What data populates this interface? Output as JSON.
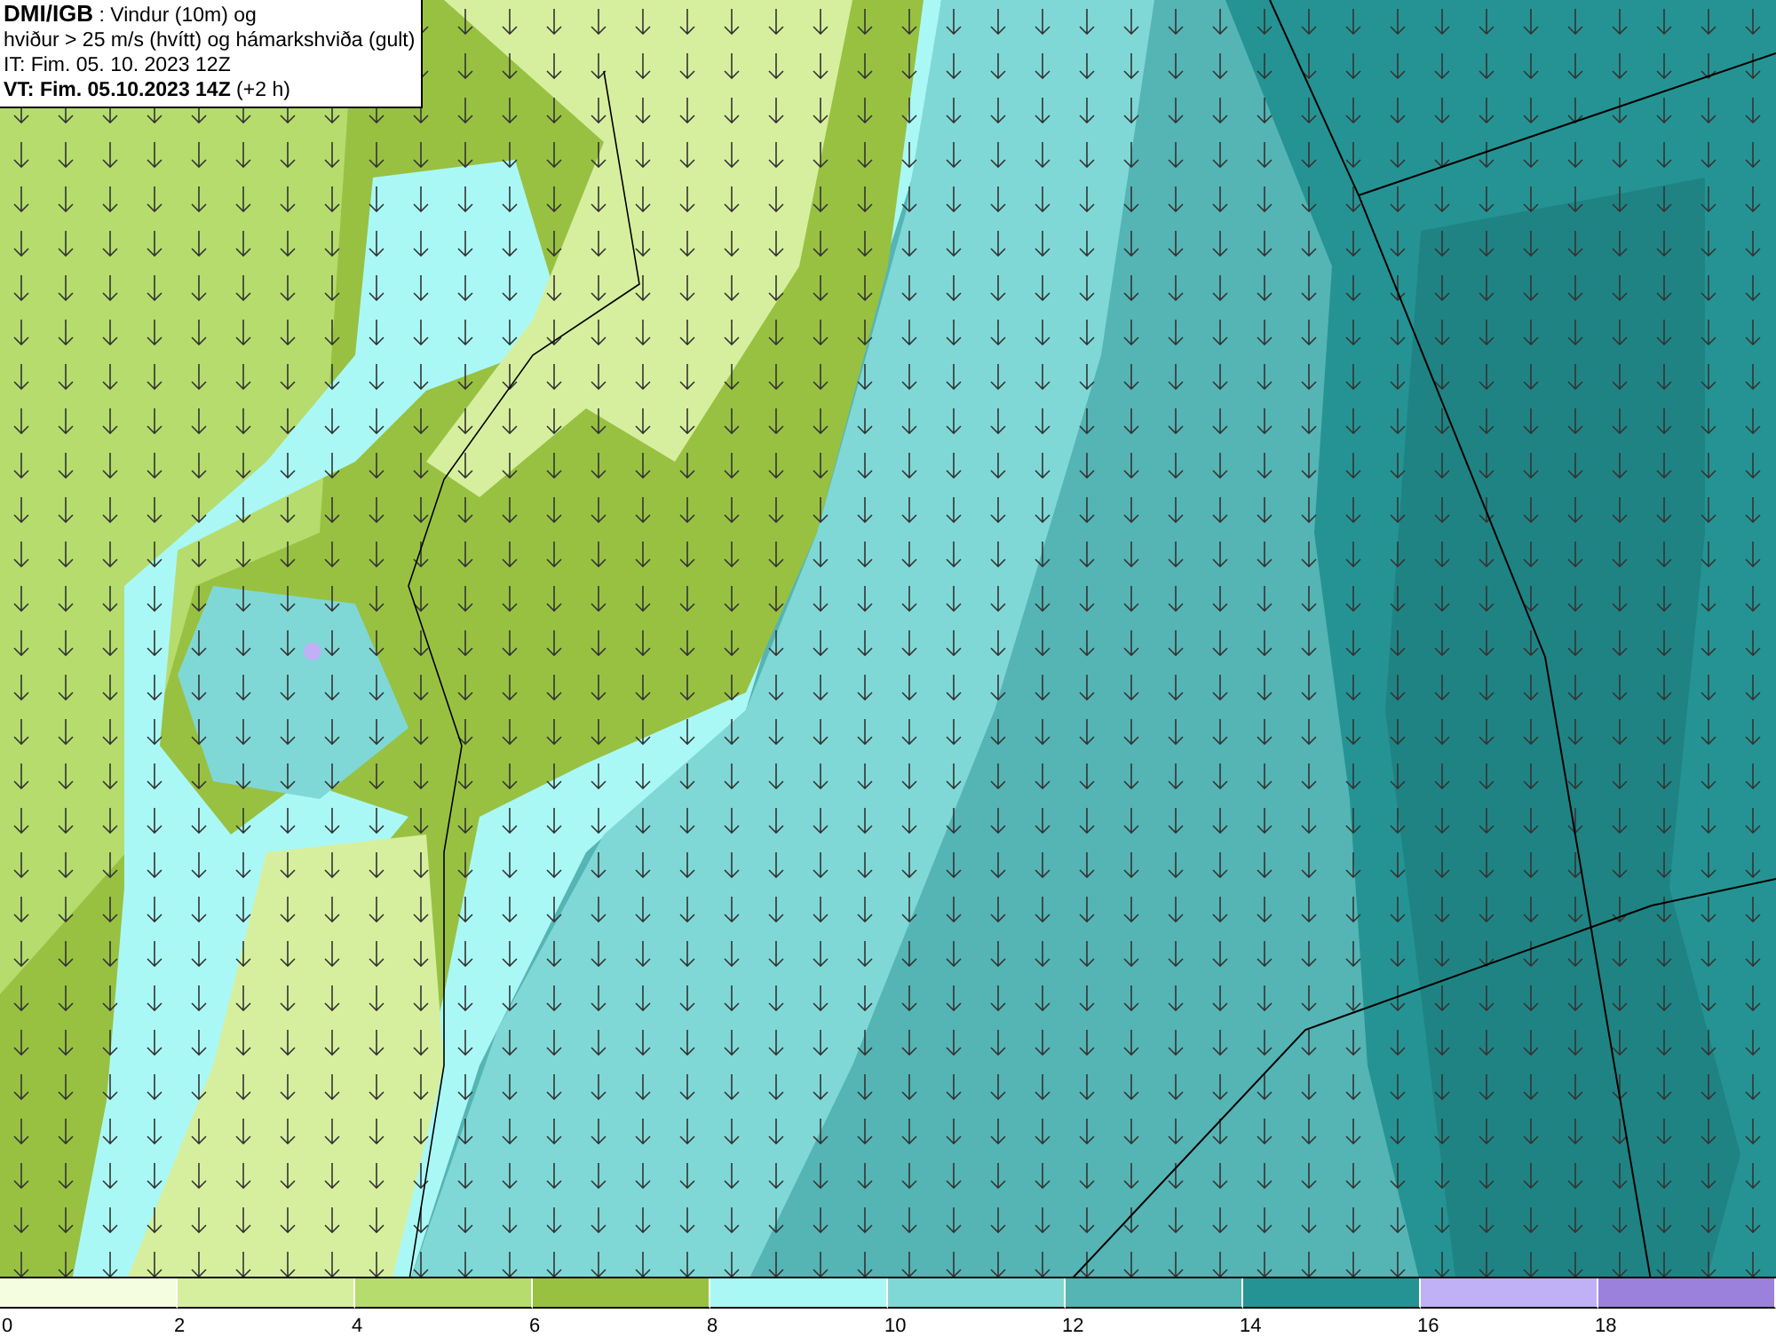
{
  "title_box": {
    "lines": [
      "**DMI/IGB** : Vindur (10m) og",
      "hviður > 25 m/s (hvítt) og hámarkshviða (gult)",
      "IT: Fim. 05. 10. 2023 12Z",
      "**VT: Fim. 05.10.2023 14Z** (+2 h)"
    ]
  },
  "legend": [
    {
      "label": "0",
      "color": "#f5fde0"
    },
    {
      "label": "2",
      "color": "#d6ef9e"
    },
    {
      "label": "4",
      "color": "#b5dc6d"
    },
    {
      "label": "6",
      "color": "#98c142"
    },
    {
      "label": "8",
      "color": "#aaf8f6"
    },
    {
      "label": "10",
      "color": "#7fd8d6"
    },
    {
      "label": "12",
      "color": "#55b4b4"
    },
    {
      "label": "14",
      "color": "#259393"
    },
    {
      "label": "16",
      "color": "#c0b0f6"
    },
    {
      "label": "18",
      "color": "#9b80dc"
    }
  ]
}
